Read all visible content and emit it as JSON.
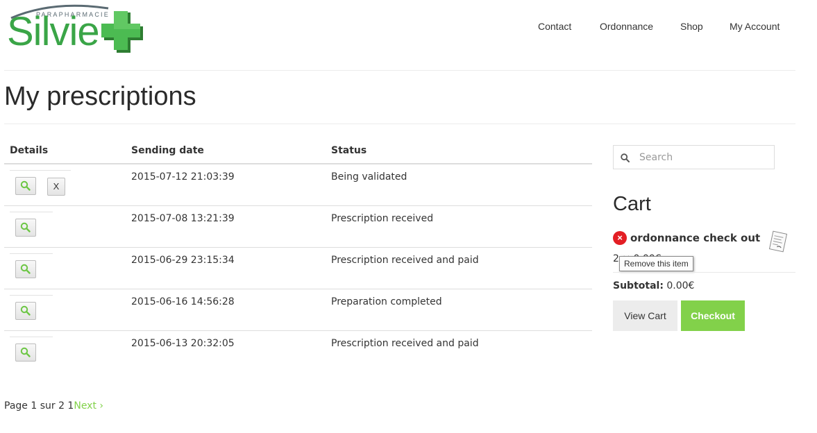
{
  "brand": {
    "name": "Silvie",
    "tagline": "PARAPHARMACIE"
  },
  "nav": {
    "items": [
      "Contact",
      "Ordonnance",
      "Shop",
      "My Account"
    ]
  },
  "page": {
    "title": "My prescriptions"
  },
  "table": {
    "headers": [
      "Details",
      "Sending date",
      "Status"
    ],
    "delete_label": "X",
    "rows": [
      {
        "date": "2015-07-12 21:03:39",
        "status": "Being validated"
      },
      {
        "date": "2015-07-08 13:21:39",
        "status": "Prescription received"
      },
      {
        "date": "2015-06-29 23:15:34",
        "status": "Prescription received and paid"
      },
      {
        "date": "2015-06-16 14:56:28",
        "status": "Preparation completed"
      },
      {
        "date": "2015-06-13 20:32:05",
        "status": "Prescription received and paid"
      }
    ]
  },
  "pagination": {
    "text": "Page 1 sur 2 1",
    "next_label": "Next ›"
  },
  "search": {
    "placeholder": "Search"
  },
  "cart": {
    "title": "Cart",
    "remove_symbol": "×",
    "item_name": "ordonnance check out",
    "item_qty_price": "2 × 0.00€",
    "tooltip": "Remove this item",
    "subtotal_label": "Subtotal:",
    "subtotal_value": "0.00€",
    "view_cart_label": "View Cart",
    "checkout_label": "Checkout"
  },
  "colors": {
    "brand_green": "#3aa547",
    "accent_green": "#82d14a",
    "remove_red": "#e31e24"
  }
}
